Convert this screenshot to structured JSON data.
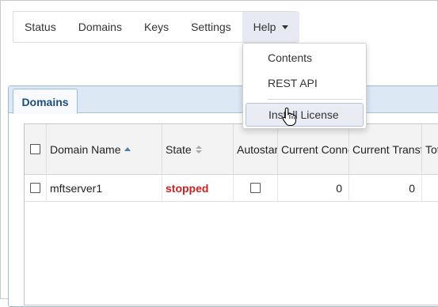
{
  "nav": {
    "items": [
      {
        "label": "Status"
      },
      {
        "label": "Domains"
      },
      {
        "label": "Keys"
      },
      {
        "label": "Settings"
      },
      {
        "label": "Help"
      }
    ]
  },
  "help_menu": {
    "items": [
      {
        "label": "Contents"
      },
      {
        "label": "REST API"
      },
      {
        "label": "Install License"
      }
    ],
    "hovered": "Install License"
  },
  "panel": {
    "tab_label": "Domains"
  },
  "grid": {
    "columns": [
      {
        "label": "Domain Name",
        "sort": "ascending"
      },
      {
        "label": "State",
        "sort": "none"
      },
      {
        "label": "Autostart"
      },
      {
        "label": "Current Connections"
      },
      {
        "label": "Current Transfers"
      },
      {
        "label": "Total"
      }
    ],
    "rows": [
      {
        "domain_name": "mftserver1",
        "state": "stopped",
        "autostart": false,
        "current_connections": "0",
        "current_transfers": "0"
      }
    ]
  },
  "colors": {
    "state_stopped": "#cc1f1f",
    "tab_text": "#1c4e80",
    "active_nav_bg": "#e8eaf3"
  },
  "icons": {
    "cursor": "hand-pointer-icon",
    "help_caret": "caret-down-icon"
  }
}
